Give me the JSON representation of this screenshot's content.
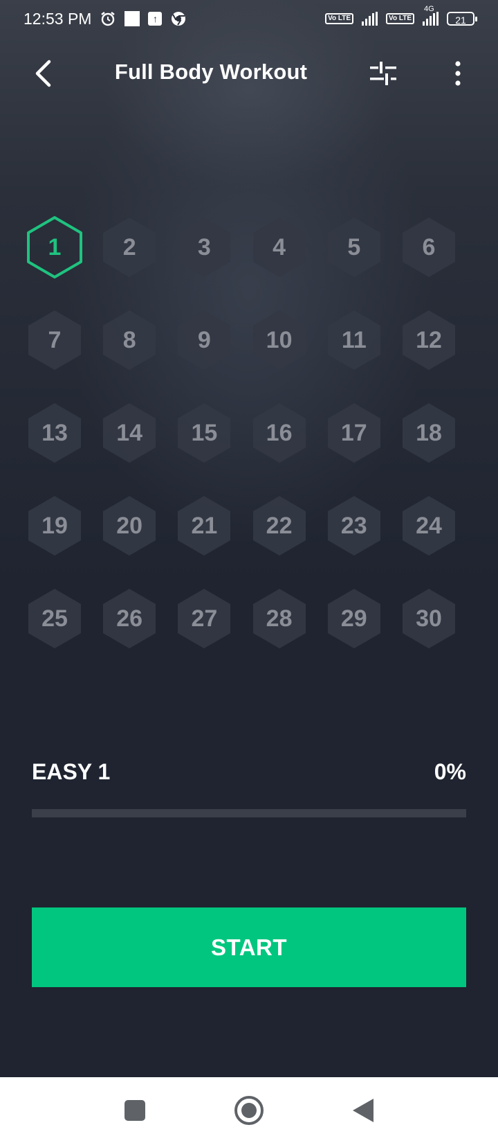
{
  "status_bar": {
    "time": "12:53 PM",
    "volte1": "Vo LTE",
    "volte2": "Vo LTE",
    "network": "4G",
    "battery": "21"
  },
  "header": {
    "title": "Full Body Workout",
    "back_icon": "back-arrow-icon",
    "adjust_icon": "sliders-icon",
    "more_icon": "more-vertical-icon"
  },
  "days": [
    "1",
    "2",
    "3",
    "4",
    "5",
    "6",
    "7",
    "8",
    "9",
    "10",
    "11",
    "12",
    "13",
    "14",
    "15",
    "16",
    "17",
    "18",
    "19",
    "20",
    "21",
    "22",
    "23",
    "24",
    "25",
    "26",
    "27",
    "28",
    "29",
    "30"
  ],
  "current_day": "1",
  "level": {
    "label": "EASY 1",
    "progress_text": "0%",
    "progress_value": 0
  },
  "start_label": "START",
  "colors": {
    "accent": "#00c67f",
    "current_day": "#1fc37f",
    "hex_inactive": "#333844",
    "day_text": "#8b8e96",
    "background": "#1f2430"
  }
}
